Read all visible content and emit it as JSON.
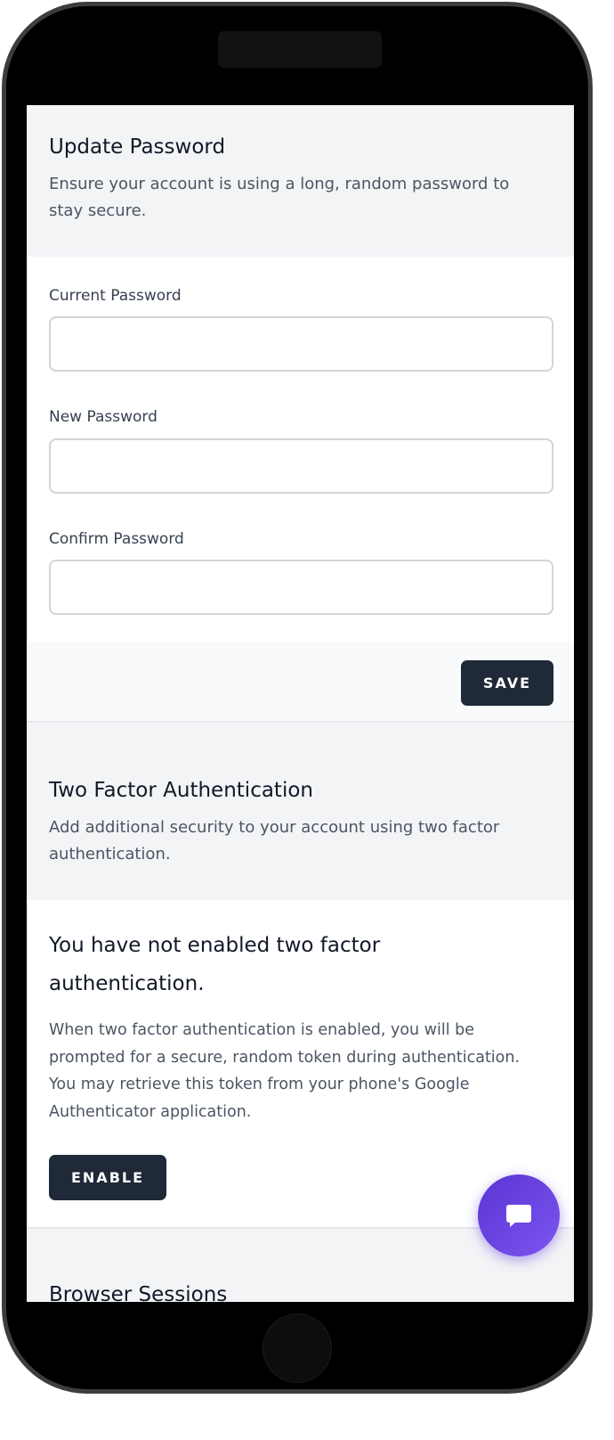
{
  "update_password": {
    "title": "Update Password",
    "description": "Ensure your account is using a long, random password to stay secure.",
    "fields": [
      {
        "label": "Current Password",
        "value": "",
        "placeholder": ""
      },
      {
        "label": "New Password",
        "value": "",
        "placeholder": ""
      },
      {
        "label": "Confirm Password",
        "value": "",
        "placeholder": ""
      }
    ],
    "save_label": "SAVE"
  },
  "two_factor": {
    "title": "Two Factor Authentication",
    "description": "Add additional security to your account using two factor authentication.",
    "status_title": "You have not enabled two factor authentication.",
    "status_description": "When two factor authentication is enabled, you will be prompted for a secure, random token during authentication. You may retrieve this token from your phone's Google Authenticator application.",
    "enable_label": "ENABLE"
  },
  "browser_sessions": {
    "title": "Browser Sessions"
  },
  "chat_fab": {
    "icon": "chat-bubble-icon",
    "color": "#6a45e3"
  },
  "colors": {
    "button_dark": "#1f2937",
    "page_bg": "#f3f4f6",
    "card_bg": "#ffffff"
  }
}
